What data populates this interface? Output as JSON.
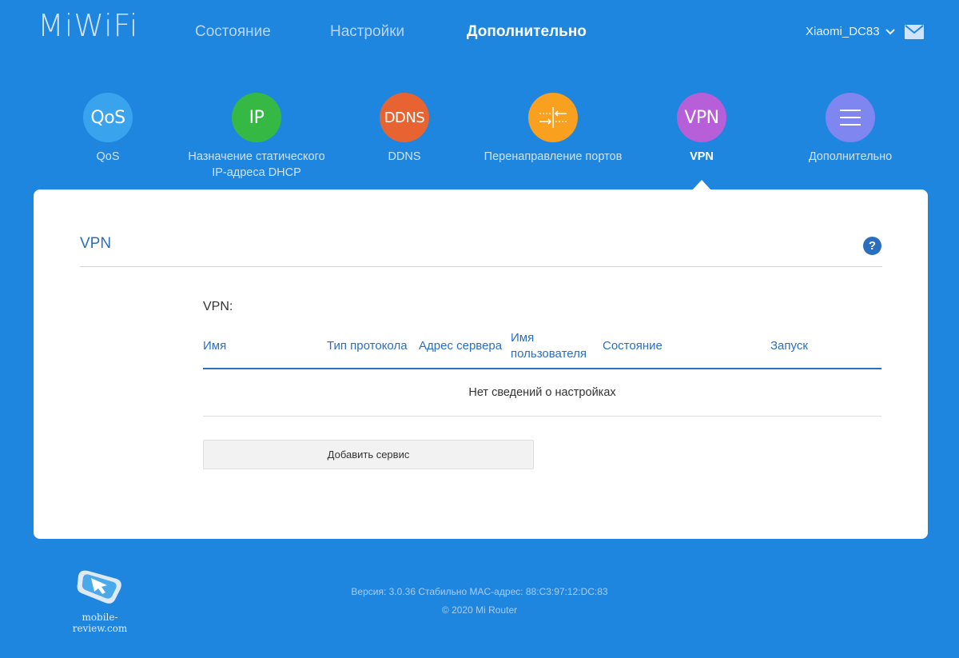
{
  "brand": {
    "logo_text": "MiWiFi"
  },
  "topnav": [
    {
      "label": "Состояние",
      "active": false
    },
    {
      "label": "Настройки",
      "active": false
    },
    {
      "label": "Дополнительно",
      "active": true
    }
  ],
  "user": {
    "name": "Xiaomi_DC83"
  },
  "features": [
    {
      "icon_text": "QoS",
      "label": "QoS",
      "color": "#3aa3ee",
      "active": false
    },
    {
      "icon_text": "IP",
      "label_line1": "Назначение статического",
      "label_line2": "IP-адреса DHCP",
      "color": "#35b944",
      "active": false
    },
    {
      "icon_text": "DDNS",
      "label": "DDNS",
      "color": "#e76432",
      "active": false
    },
    {
      "icon_text": "",
      "label": "Перенаправление портов",
      "color": "#f9a01f",
      "active": false
    },
    {
      "icon_text": "VPN",
      "label": "VPN",
      "color": "#b65fd8",
      "active": true
    },
    {
      "icon_text": "",
      "label": "Дополнительно",
      "color": "#7f86f0",
      "active": false
    }
  ],
  "card": {
    "title": "VPN",
    "help_label": "?",
    "section_label": "VPN:",
    "columns": {
      "name": "Имя",
      "protocol": "Тип протокола",
      "server": "Адрес сервера",
      "user_line1": "Имя",
      "user_line2": "пользователя",
      "state": "Состояние",
      "launch": "Запуск"
    },
    "empty_text": "Нет сведений о настройках",
    "add_button": "Добавить сервис"
  },
  "footer": {
    "version": "Версия: 3.0.36 Стабильно  MAC-адрес: 88:C3:97:12:DC:83",
    "copyright": "© 2020 Mi Router"
  },
  "watermark": {
    "text": "mobile-review.com"
  }
}
